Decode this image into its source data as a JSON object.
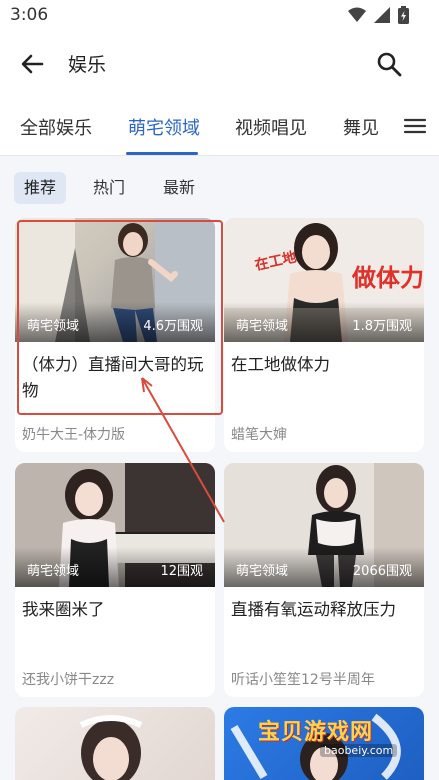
{
  "status": {
    "time": "3:06"
  },
  "header": {
    "title": "娱乐"
  },
  "tabs": [
    {
      "label": "全部娱乐"
    },
    {
      "label": "萌宅领域"
    },
    {
      "label": "视频唱见"
    },
    {
      "label": "舞见"
    }
  ],
  "filters": [
    {
      "label": "推荐"
    },
    {
      "label": "热门"
    },
    {
      "label": "最新"
    }
  ],
  "cards": [
    {
      "category": "萌宅领域",
      "views": "4.6万围观",
      "title": "（体力）直播间大哥的玩物",
      "author": "奶牛大王-体力版",
      "thumb_text": ""
    },
    {
      "category": "萌宅领域",
      "views": "1.8万围观",
      "title": "在工地做体力",
      "author": "蜡笔大婶",
      "thumb_text": "做体力"
    },
    {
      "category": "萌宅领域",
      "views": "12围观",
      "title": "我来圈米了",
      "author": "还我小饼干zzz",
      "thumb_text": ""
    },
    {
      "category": "萌宅领域",
      "views": "2066围观",
      "title": "直播有氧运动释放压力",
      "author": "听话小笙笙12号半周年",
      "thumb_text": ""
    }
  ],
  "watermark": {
    "text": "宝贝游戏网",
    "url": "baobeiy.com"
  },
  "colors": {
    "accent": "#2b66c6",
    "annotation": "#d94b3d"
  }
}
